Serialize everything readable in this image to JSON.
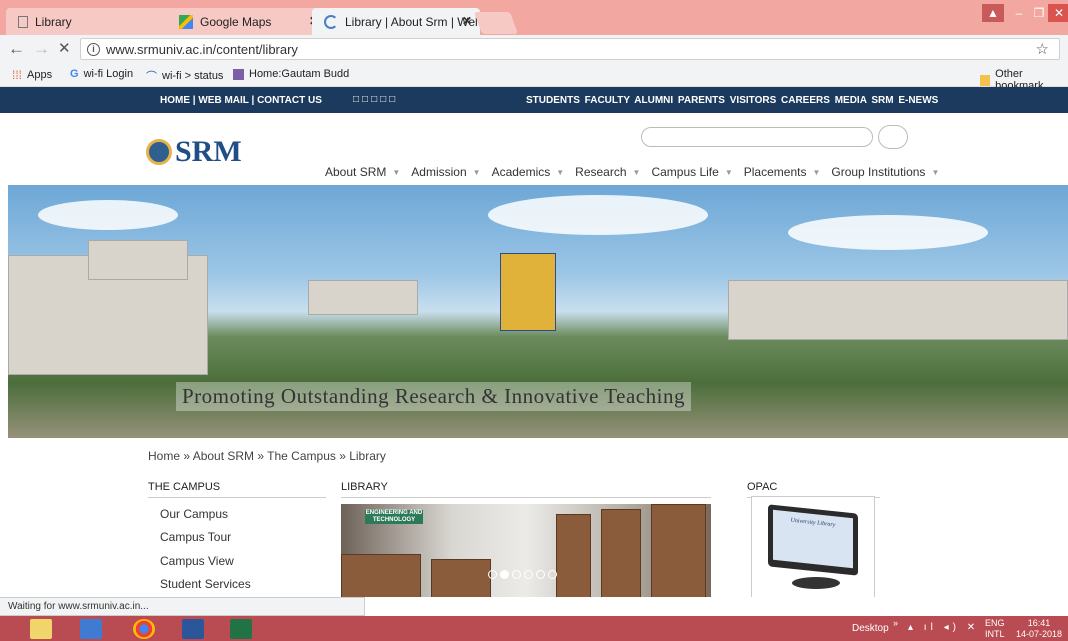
{
  "browser": {
    "tabs": [
      {
        "title": "Library"
      },
      {
        "title": "Google Maps"
      },
      {
        "title": "Library | About Srm | Wel"
      }
    ],
    "url": "www.srmuniv.ac.in/content/library",
    "bookmarks": [
      {
        "label": "Apps"
      },
      {
        "label": "wi-fi Login"
      },
      {
        "label": "wi-fi > status"
      },
      {
        "label": "Home:Gautam Budd"
      }
    ],
    "other_bookmarks": "Other bookmark",
    "status": "Waiting for www.srmuniv.ac.in..."
  },
  "site": {
    "topbar_left": "HOME | WEB MAIL | CONTACT US",
    "topbar_boxes": "□□□□□",
    "topbar_right": "STUDENTS FACULTY ALUMNI PARENTS VISITORS CAREERS MEDIA SRM E-NEWS",
    "logo_text": "SRM",
    "nav": [
      "About SRM",
      "Admission",
      "Academics",
      "Research",
      "Campus Life",
      "Placements",
      "Group Institutions"
    ],
    "banner_caption": "Promoting Outstanding Research & Innovative Teaching",
    "breadcrumb": "Home  »  About SRM  »  The Campus  »  Library",
    "campus_heading": "THE CAMPUS",
    "campus_links": [
      "Our Campus",
      "Campus Tour",
      "Campus View",
      "Student Services"
    ],
    "library_heading": "LIBRARY",
    "library_sign": "ENGINEERING AND TECHNOLOGY",
    "opac_heading": "OPAC",
    "opac_screen_text": "University Library"
  },
  "taskbar": {
    "desktop": "Desktop",
    "lang_top": "ENG",
    "lang_bottom": "INTL",
    "time": "16:41",
    "date": "14-07-2018"
  },
  "colors": {
    "tabstrip": "#f2a7a0",
    "site_topbar": "#1b3a5e",
    "taskbar": "#b94b52",
    "logo": "#1f4f86"
  }
}
